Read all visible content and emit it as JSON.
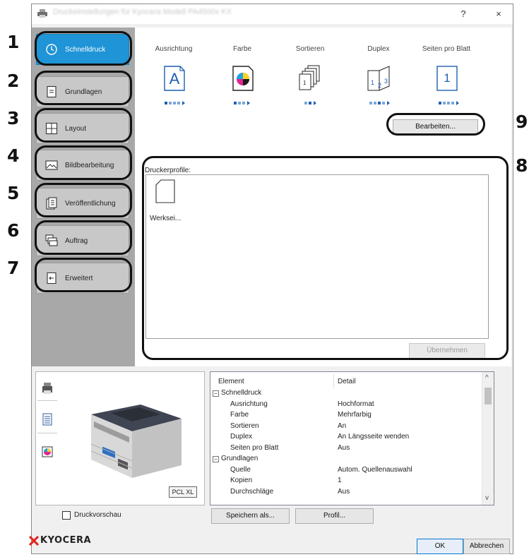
{
  "window": {
    "title": "Druckeinstellungen für Kyocera Modell PA4500x KX",
    "help": "?",
    "close": "×"
  },
  "tabs": [
    {
      "label": "Schnelldruck",
      "icon": "clock-icon",
      "active": true
    },
    {
      "label": "Grundlagen",
      "icon": "document-icon",
      "active": false
    },
    {
      "label": "Layout",
      "icon": "grid-icon",
      "active": false
    },
    {
      "label": "Bildbearbeitung",
      "icon": "image-icon",
      "active": false
    },
    {
      "label": "Veröffentlichung",
      "icon": "booklet-icon",
      "active": false
    },
    {
      "label": "Auftrag",
      "icon": "job-stack-icon",
      "active": false
    },
    {
      "label": "Erweitert",
      "icon": "advanced-icon",
      "active": false
    }
  ],
  "callouts": [
    "1",
    "2",
    "3",
    "4",
    "5",
    "6",
    "7",
    "8",
    "9"
  ],
  "quick": {
    "columns": [
      {
        "label": "Ausrichtung",
        "icon": "orientation-icon"
      },
      {
        "label": "Farbe",
        "icon": "color-icon"
      },
      {
        "label": "Sortieren",
        "icon": "collate-icon"
      },
      {
        "label": "Duplex",
        "icon": "duplex-icon"
      },
      {
        "label": "Seiten pro Blatt",
        "icon": "pages-per-sheet-icon"
      }
    ],
    "orientation_letter": "A",
    "pps_value": "1",
    "edit_button": "Bearbeiten..."
  },
  "profiles": {
    "heading": "Druckerprofile:",
    "items": [
      {
        "label": "Werksei...",
        "icon": "page-icon"
      }
    ],
    "apply_button": "Übernehmen"
  },
  "preview": {
    "badge": "PCL XL",
    "side_icons": [
      "printer-icon",
      "page-icon",
      "color-icon"
    ],
    "checkbox_label": "Druckvorschau"
  },
  "detail": {
    "headers": [
      "Element",
      "Detail"
    ],
    "rows": [
      {
        "label": "Schnelldruck",
        "value": "",
        "group": true
      },
      {
        "label": "Ausrichtung",
        "value": "Hochformat",
        "group": false
      },
      {
        "label": "Farbe",
        "value": "Mehrfarbig",
        "group": false
      },
      {
        "label": "Sortieren",
        "value": "An",
        "group": false
      },
      {
        "label": "Duplex",
        "value": "An Längsseite wenden",
        "group": false
      },
      {
        "label": "Seiten pro Blatt",
        "value": "Aus",
        "group": false
      },
      {
        "label": "Grundlagen",
        "value": "",
        "group": true
      },
      {
        "label": "Quelle",
        "value": "Autom. Quellenauswahl",
        "group": false
      },
      {
        "label": "Kopien",
        "value": "1",
        "group": false
      },
      {
        "label": "Durchschläge",
        "value": "Aus",
        "group": false
      }
    ],
    "scroll_up": "^",
    "scroll_down": "v"
  },
  "buttons": {
    "save_as": "Speichern als...",
    "profile": "Profil...",
    "ok": "OK",
    "cancel": "Abbrechen"
  },
  "brand": {
    "name": "KYOCERA",
    "color": "#e2231a"
  },
  "colors": {
    "accent": "#1f94d6",
    "tab_inactive": "#c8c8c8",
    "tab_strip": "#a8a8a8"
  }
}
